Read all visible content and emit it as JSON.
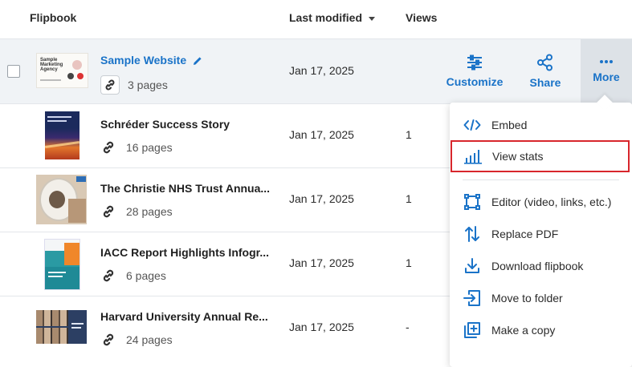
{
  "header": {
    "flipbook": "Flipbook",
    "last_modified": "Last modified",
    "views": "Views"
  },
  "rows": [
    {
      "title": "Sample Website",
      "pages": "3 pages",
      "date": "Jan 17, 2025",
      "views": "",
      "thumb_text": "Sample Marketing Agency"
    },
    {
      "title": "Schréder Success Story",
      "pages": "16 pages",
      "date": "Jan 17, 2025",
      "views": "1"
    },
    {
      "title": "The Christie NHS Trust Annua...",
      "pages": "28 pages",
      "date": "Jan 17, 2025",
      "views": "1"
    },
    {
      "title": "IACC Report Highlights Infogr...",
      "pages": "6 pages",
      "date": "Jan 17, 2025",
      "views": "1"
    },
    {
      "title": "Harvard University Annual Re...",
      "pages": "24 pages",
      "date": "Jan 17, 2025",
      "views": "-"
    }
  ],
  "actions": {
    "customize": "Customize",
    "share": "Share",
    "more": "More"
  },
  "menu": {
    "items": [
      {
        "label": "Embed",
        "icon": "code-icon"
      },
      {
        "label": "View stats",
        "icon": "bar-chart-icon"
      },
      {
        "label": "Editor (video, links, etc.)",
        "icon": "editor-icon"
      },
      {
        "label": "Replace PDF",
        "icon": "swap-icon"
      },
      {
        "label": "Download flipbook",
        "icon": "download-icon"
      },
      {
        "label": "Move to folder",
        "icon": "move-icon"
      },
      {
        "label": "Make a copy",
        "icon": "copy-icon"
      }
    ]
  },
  "colors": {
    "accent": "#1a73c8",
    "highlight_border": "#d8262c",
    "selected_row": "#f0f3f6",
    "more_button_bg": "#dde2e7"
  }
}
